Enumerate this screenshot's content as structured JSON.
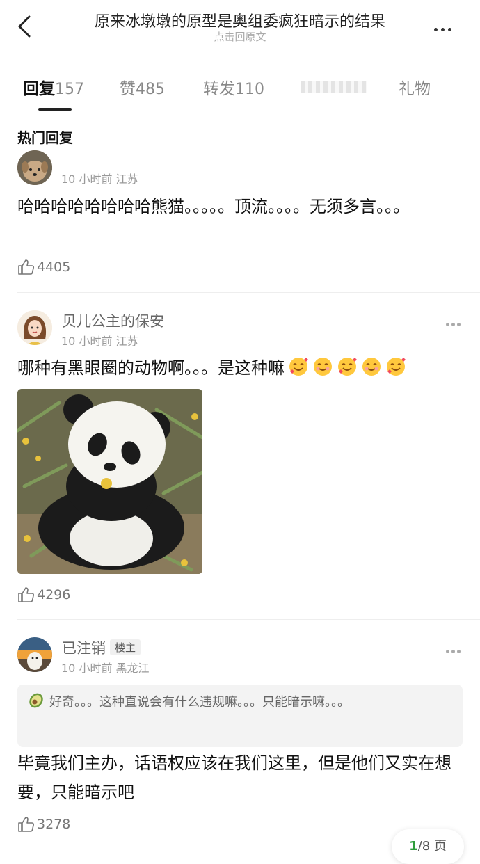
{
  "header": {
    "title": "原来冰墩墩的原型是奥组委疯狂暗示的结果",
    "subtitle": "点击回原文"
  },
  "tabs": [
    {
      "label": "回复",
      "count": "157"
    },
    {
      "label": "赞",
      "count": "485"
    },
    {
      "label": "转发",
      "count": "110"
    },
    {
      "label": "礼物",
      "count": ""
    }
  ],
  "section_title": "热门回复",
  "comments": [
    {
      "username": "",
      "time": "10 小时前",
      "location": "江苏",
      "text": "哈哈哈哈哈哈哈哈熊猫。。。。。顶流。。。。无须多言。。。",
      "likes": "4405"
    },
    {
      "username": "贝儿公主的保安",
      "time": "10 小时前",
      "location": "江苏",
      "text": "哪种有黑眼圈的动物啊。。。是这种嘛",
      "likes": "4296"
    },
    {
      "username": "已注销",
      "badge": "楼主",
      "time": "10 小时前",
      "location": "黑龙江",
      "quote": "好奇。。。这种直说会有什么违规嘛。。。只能暗示嘛。。。",
      "text": "毕竟我们主办，话语权应该在我们这里，但是他们又实在想要，只能暗示吧",
      "likes": "3278"
    }
  ],
  "pager": {
    "current": "1",
    "total": "/8 页"
  },
  "colors": {
    "accent": "#2d9c3a",
    "text": "#111111",
    "muted": "#999999"
  }
}
